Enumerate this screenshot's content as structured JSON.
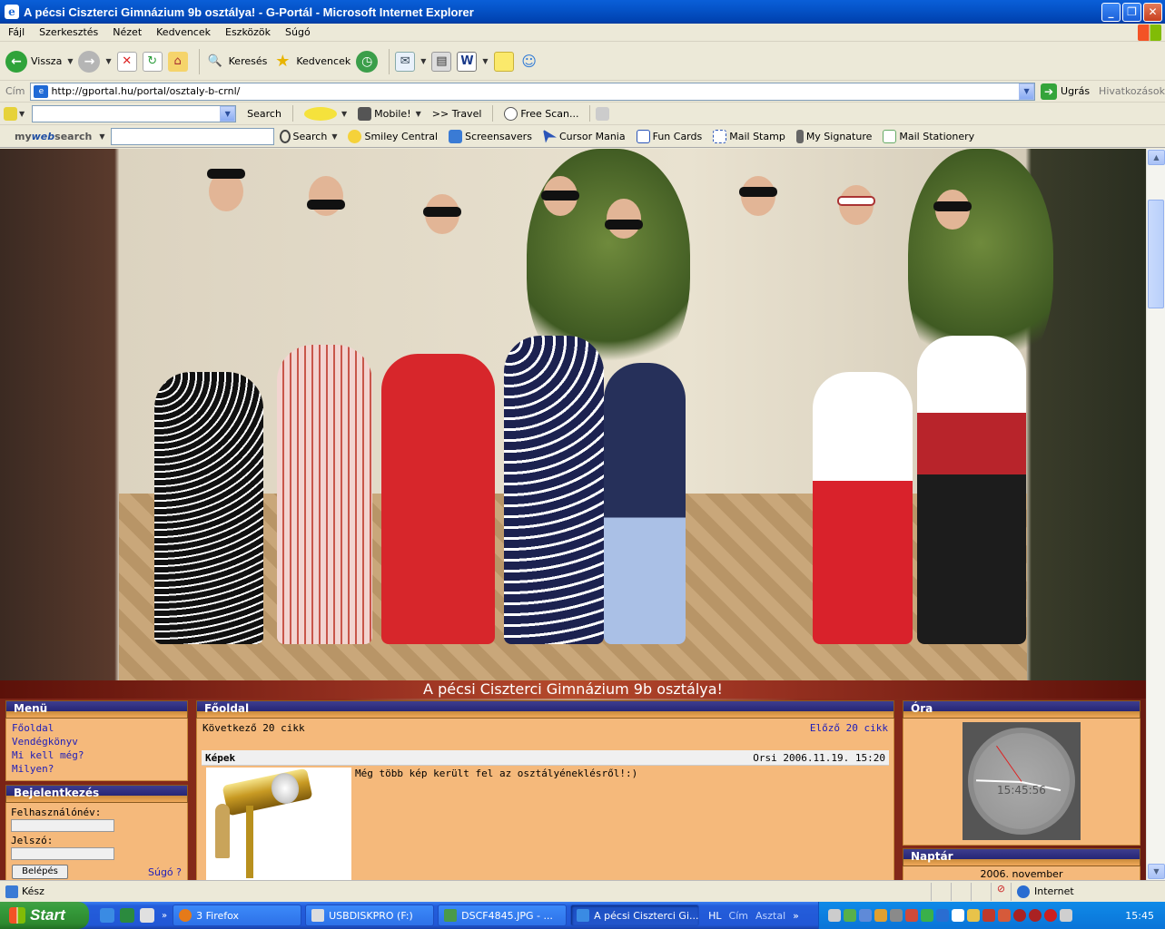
{
  "window": {
    "title": "A pécsi Ciszterci Gimnázium 9b osztálya! - G-Portál - Microsoft Internet Explorer",
    "minimize": "_",
    "maximize": "❐",
    "close": "✕"
  },
  "menu": {
    "items": [
      "Fájl",
      "Szerkesztés",
      "Nézet",
      "Kedvencek",
      "Eszközök",
      "Súgó"
    ]
  },
  "toolbar": {
    "back_label": "Vissza",
    "search_label": "Keresés",
    "favorites_label": "Kedvencek"
  },
  "address": {
    "label": "Cím",
    "url": "http://gportal.hu/portal/osztaly-b-crnl/",
    "go_label": "Ugrás",
    "links_label": "Hivatkozások"
  },
  "searchbar1": {
    "search_label": "Search",
    "mobile_label": "Mobile!",
    "travel_label": ">> Travel",
    "freescan_label": "Free Scan..."
  },
  "searchbar2": {
    "brand_my": "my",
    "brand_web": "web",
    "brand_search": "search",
    "search_label": "Search",
    "items": [
      "Smiley Central",
      "Screensavers",
      "Cursor Mania",
      "Fun Cards",
      "Mail Stamp",
      "My Signature",
      "Mail Stationery"
    ]
  },
  "page": {
    "site_title": "A pécsi Ciszterci Gimnázium 9b osztálya!",
    "menu_box": {
      "title": "Menü",
      "links": [
        "Főoldal",
        "Vendégkönyv",
        "Mi kell még?",
        "Milyen?"
      ]
    },
    "login_box": {
      "title": "Bejelentkezés",
      "username_label": "Felhasználónév:",
      "password_label": "Jelszó:",
      "login_button": "Belépés",
      "help_link": "Súgó"
    },
    "main_box": {
      "title": "Főoldal",
      "next_link": "Következő 20 cikk",
      "prev_link": "Előző 20 cikk",
      "article": {
        "title": "Képek",
        "author_date": "Orsi  2006.11.19. 15:20",
        "text": "Még több kép került fel az osztályéneklésről!:)"
      }
    },
    "clock_box": {
      "title": "Óra",
      "time": "15:45:56"
    },
    "calendar_box": {
      "title": "Naptár",
      "month": "2006. november"
    }
  },
  "status": {
    "text": "Kész",
    "zone": "Internet"
  },
  "taskbar": {
    "start_label": "Start",
    "tasks": [
      "3 Firefox",
      "USBDISKPRO (F:)",
      "DSCF4845.JPG - ...",
      "A pécsi Ciszterci Gi..."
    ],
    "lang": "HL",
    "cim": "Cím",
    "asztal": "Asztal",
    "time": "15:45"
  },
  "colors": {
    "box_header": "#262676",
    "box_body": "#f5b97b",
    "link": "#1d1dba",
    "title_band": "#9b3322"
  }
}
